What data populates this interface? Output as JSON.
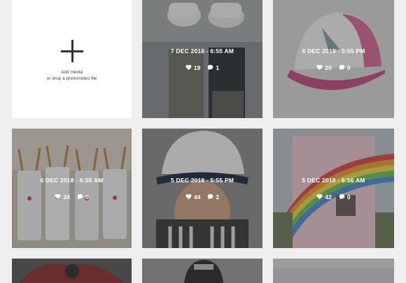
{
  "add_media": {
    "title": "Add media",
    "subtitle": "or drop a photo/video file"
  },
  "posts": [
    {
      "date": "7 DEC 2018 - 6:55 AM",
      "likes": "19",
      "comments": "1"
    },
    {
      "date": "6 DEC 2018 - 5:55 PM",
      "likes": "20",
      "comments": "0"
    },
    {
      "date": "6 DEC 2018 - 6:55 AM",
      "likes": "24",
      "comments": "0"
    },
    {
      "date": "5 DEC 2018 - 5:55 PM",
      "likes": "44",
      "comments": "2"
    },
    {
      "date": "5 DEC 2018 - 6:56 AM",
      "likes": "42",
      "comments": "0"
    },
    {
      "date": "",
      "likes": "",
      "comments": ""
    },
    {
      "date": "",
      "likes": "",
      "comments": ""
    },
    {
      "date": "",
      "likes": "",
      "comments": ""
    }
  ],
  "icons": {
    "like": "heart-icon",
    "comment": "comment-icon",
    "add": "plus-icon"
  },
  "colors": {
    "overlay_text": "#ffffff",
    "background": "#efefef"
  }
}
